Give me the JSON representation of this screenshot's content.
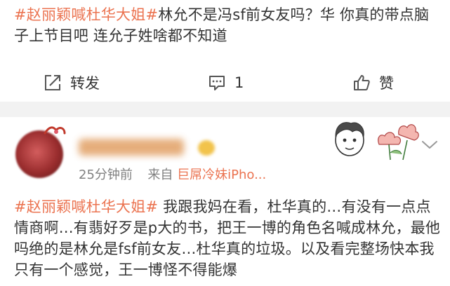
{
  "post1": {
    "hashtag": "#赵丽颖喊杜华大姐#",
    "body": "林允不是冯sf前女友吗？华 你真的带点脑子上节目吧 连允子姓啥都不知道"
  },
  "actions": {
    "repost_label": "转发",
    "comment_count": "1",
    "like_label": "赞"
  },
  "comment": {
    "time": "25分钟前",
    "source_prefix": "来自",
    "source": "巨屌冷妹iPho...",
    "hashtag": "#赵丽颖喊杜华大姐#",
    "body": " 我跟我妈在看，杜华真的…有没有一点点情商啊…有翡好歹是p大的书，把王一博的角色名喊成林允，最他吗绝的是林允是fsf前女友…杜华真的垃圾。以及看完整场快本我只有一个感觉，王一博怪不得能爆"
  },
  "colors": {
    "accent": "#eb7350",
    "text": "#333333",
    "meta": "#808080",
    "divider": "#f2f2f2"
  },
  "icons": [
    "repost-icon",
    "comment-icon",
    "like-icon",
    "chevron-down-icon",
    "vip-badge-icon"
  ]
}
